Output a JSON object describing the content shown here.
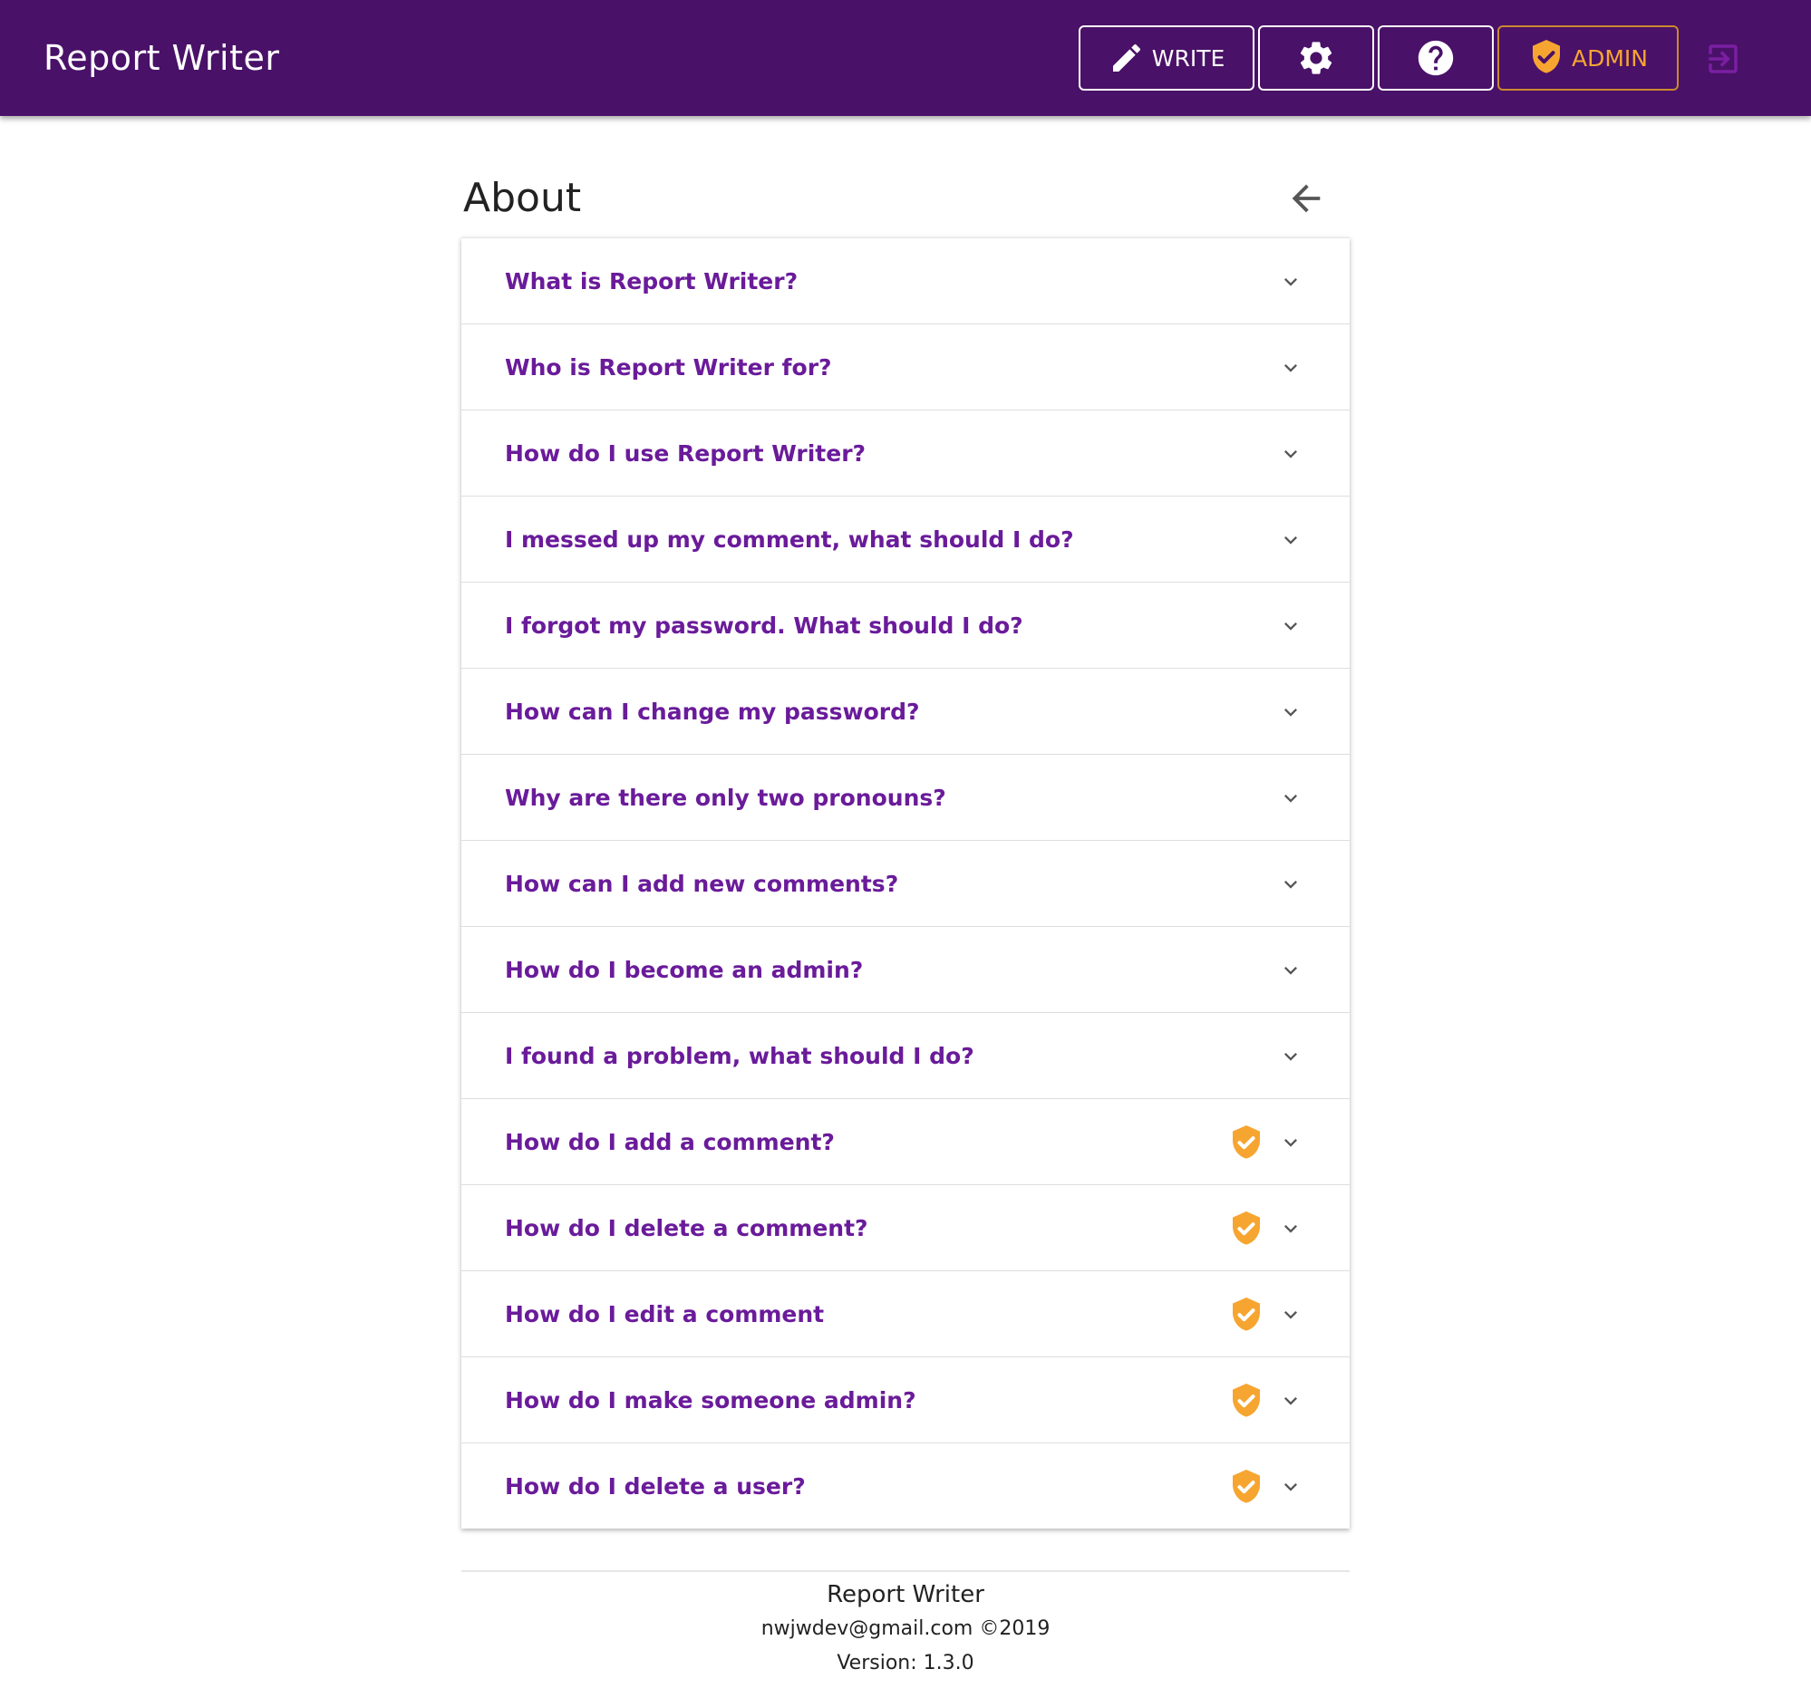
{
  "header": {
    "app_title": "Report Writer",
    "write_label": "WRITE",
    "admin_label": "ADMIN",
    "brand_color": "#4a1168",
    "admin_color": "#f7a531"
  },
  "page": {
    "title": "About"
  },
  "faq": {
    "items": [
      {
        "question": "What is Report Writer?",
        "admin": false
      },
      {
        "question": "Who is Report Writer for?",
        "admin": false
      },
      {
        "question": "How do I use Report Writer?",
        "admin": false
      },
      {
        "question": "I messed up my comment, what should I do?",
        "admin": false
      },
      {
        "question": "I forgot my password. What should I do?",
        "admin": false
      },
      {
        "question": "How can I change my password?",
        "admin": false
      },
      {
        "question": "Why are there only two pronouns?",
        "admin": false
      },
      {
        "question": "How can I add new comments?",
        "admin": false
      },
      {
        "question": "How do I become an admin?",
        "admin": false
      },
      {
        "question": "I found a problem, what should I do?",
        "admin": false
      },
      {
        "question": "How do I add a comment?",
        "admin": true
      },
      {
        "question": "How do I delete a comment?",
        "admin": true
      },
      {
        "question": "How do I edit a comment",
        "admin": true
      },
      {
        "question": "How do I make someone admin?",
        "admin": true
      },
      {
        "question": "How do I delete a user?",
        "admin": true
      }
    ]
  },
  "footer": {
    "name": "Report Writer",
    "contact": "nwjwdev@gmail.com ©2019",
    "version": "Version: 1.3.0"
  }
}
